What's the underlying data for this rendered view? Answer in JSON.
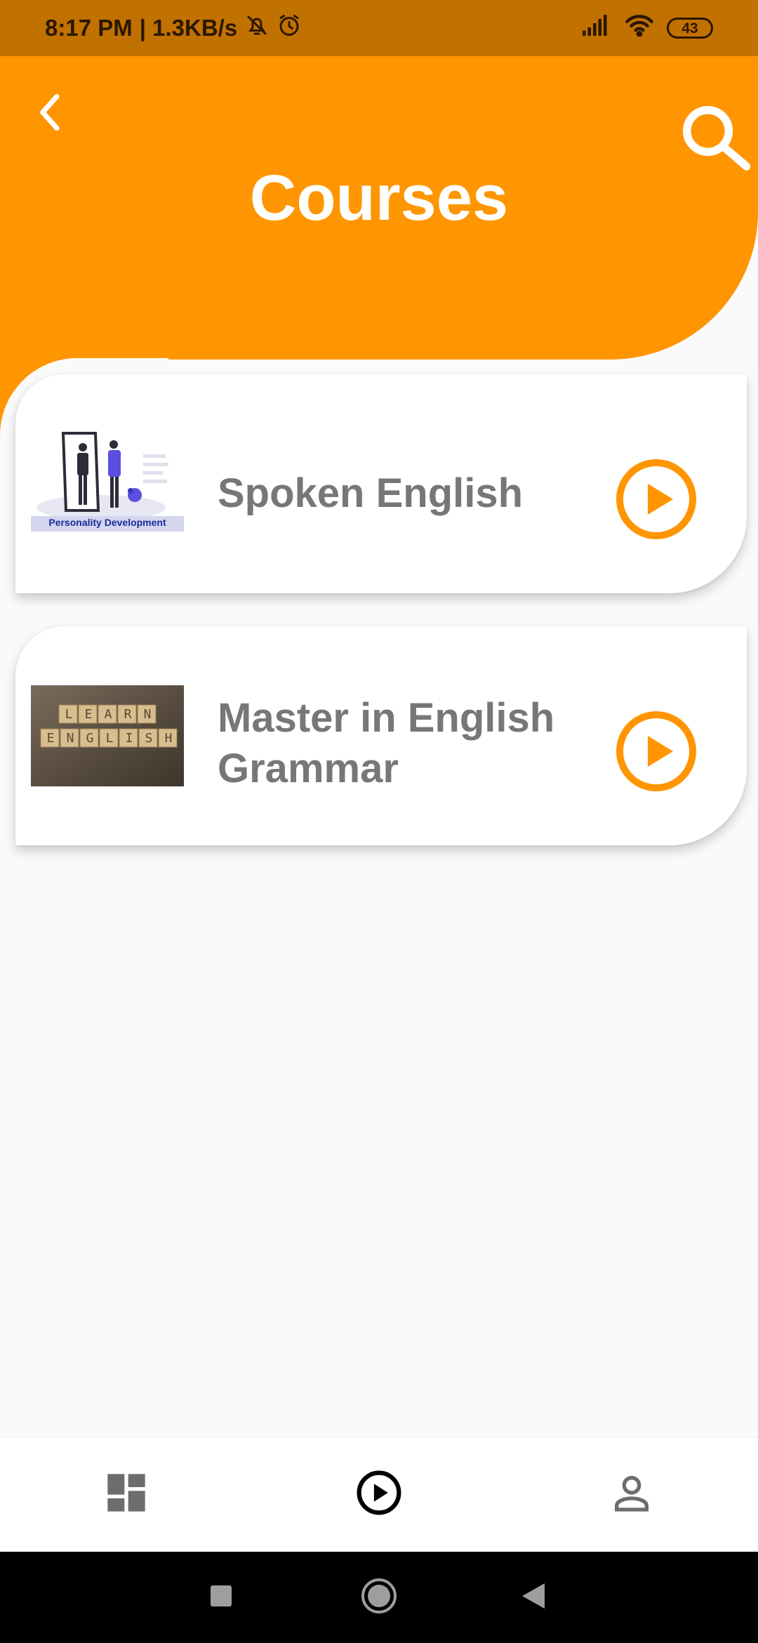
{
  "status_bar": {
    "time": "8:17 PM",
    "speed": "| 1.3KB/s",
    "battery": "43",
    "icons": [
      "bell-off-icon",
      "alarm-icon",
      "signal-icon",
      "wifi-icon",
      "battery-icon"
    ]
  },
  "header": {
    "title": "Courses",
    "back_icon": "chevron-left-icon",
    "search_icon": "search-icon",
    "background_color": "#ff9500"
  },
  "courses": [
    {
      "title": "Spoken English",
      "thumbnail_caption": "Personality Development",
      "action_icon": "play-circle-icon"
    },
    {
      "title": "Master in English Grammar",
      "thumbnail_letters_top": [
        "L",
        "E",
        "A",
        "R",
        "N"
      ],
      "thumbnail_letters_bottom": [
        "E",
        "N",
        "G",
        "L",
        "I",
        "S",
        "H"
      ],
      "action_icon": "play-circle-icon"
    }
  ],
  "bottom_nav": {
    "items": [
      {
        "name": "dashboard",
        "icon": "dashboard-icon"
      },
      {
        "name": "courses",
        "icon": "play-circle-icon",
        "active": true
      },
      {
        "name": "profile",
        "icon": "person-icon"
      }
    ]
  },
  "system_nav": {
    "items": [
      "recents-icon",
      "home-icon",
      "back-icon"
    ]
  },
  "colors": {
    "accent": "#ff9500",
    "status_bar": "#c17100",
    "title_text": "#777777",
    "nav_icon": "#6d6d6d"
  }
}
